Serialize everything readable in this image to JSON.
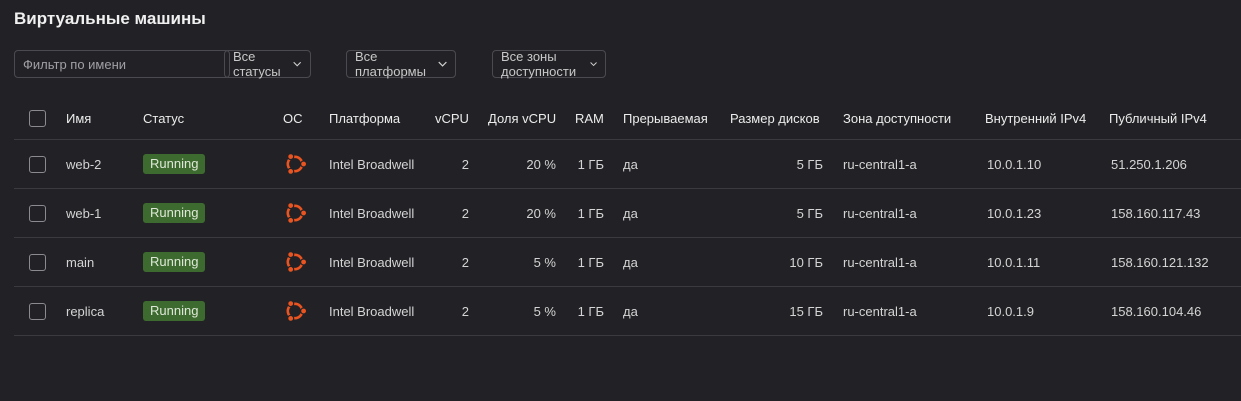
{
  "page_title": "Виртуальные машины",
  "filters": {
    "name_placeholder": "Фильтр по имени",
    "status_label": "Все статусы",
    "platform_label": "Все платформы",
    "zone_label": "Все зоны доступности"
  },
  "table": {
    "headers": {
      "name": "Имя",
      "status": "Статус",
      "os": "ОС",
      "platform": "Платформа",
      "vcpu": "vCPU",
      "vcpu_share": "Доля vCPU",
      "ram": "RAM",
      "preemptible": "Прерываемая",
      "disk_size": "Размер дисков",
      "zone": "Зона доступности",
      "internal_ip": "Внутренний IPv4",
      "public_ip": "Публичный IPv4"
    },
    "rows": [
      {
        "name": "web-2",
        "status": "Running",
        "os_icon": "ubuntu-icon",
        "platform": "Intel Broadwell",
        "vcpu": "2",
        "vcpu_share": "20 %",
        "ram": "1 ГБ",
        "preemptible": "да",
        "disk_size": "5 ГБ",
        "zone": "ru-central1-a",
        "internal_ip": "10.0.1.10",
        "public_ip": "51.250.1.206"
      },
      {
        "name": "web-1",
        "status": "Running",
        "os_icon": "ubuntu-icon",
        "platform": "Intel Broadwell",
        "vcpu": "2",
        "vcpu_share": "20 %",
        "ram": "1 ГБ",
        "preemptible": "да",
        "disk_size": "5 ГБ",
        "zone": "ru-central1-a",
        "internal_ip": "10.0.1.23",
        "public_ip": "158.160.117.43"
      },
      {
        "name": "main",
        "status": "Running",
        "os_icon": "ubuntu-icon",
        "platform": "Intel Broadwell",
        "vcpu": "2",
        "vcpu_share": "5 %",
        "ram": "1 ГБ",
        "preemptible": "да",
        "disk_size": "10 ГБ",
        "zone": "ru-central1-a",
        "internal_ip": "10.0.1.11",
        "public_ip": "158.160.121.132"
      },
      {
        "name": "replica",
        "status": "Running",
        "os_icon": "ubuntu-icon",
        "platform": "Intel Broadwell",
        "vcpu": "2",
        "vcpu_share": "5 %",
        "ram": "1 ГБ",
        "preemptible": "да",
        "disk_size": "15 ГБ",
        "zone": "ru-central1-a",
        "internal_ip": "10.0.1.9",
        "public_ip": "158.160.104.46"
      }
    ]
  },
  "colors": {
    "background": "#222226",
    "status_running": "#3d6b2f",
    "ubuntu": "#e95420"
  }
}
